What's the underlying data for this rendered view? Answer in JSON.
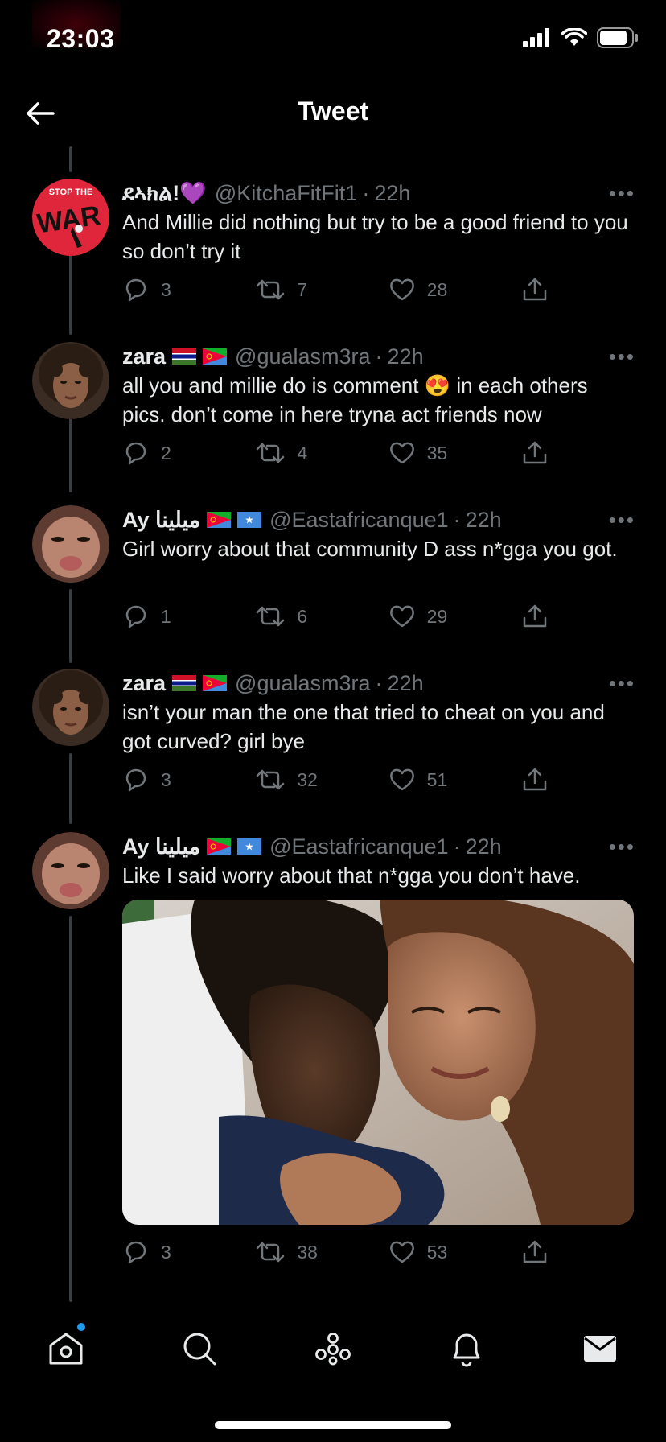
{
  "status_bar": {
    "time": "23:03",
    "icons": [
      "signal-icon",
      "wifi-icon",
      "battery-icon"
    ]
  },
  "header": {
    "title": "Tweet",
    "back_icon": "arrow-left-icon"
  },
  "tweets": [
    {
      "display_name": "ደኣክል!💜",
      "handle": "@KitchaFitFit1",
      "time": "22h",
      "text": "And Millie did nothing but try to be a good friend to you so don’t try it",
      "replies": "3",
      "retweets": "7",
      "likes": "28",
      "avatar": "stop-the-war-avatar"
    },
    {
      "display_name": "zara",
      "flags": [
        "gambia-flag",
        "eritrea-flag"
      ],
      "handle": "@gualasm3ra",
      "time": "22h",
      "text": "all you and millie do is comment 😍 in each others pics. don’t come in here tryna act friends now",
      "replies": "2",
      "retweets": "4",
      "likes": "35",
      "avatar": "zara-avatar"
    },
    {
      "display_name": "Ay ميلينا",
      "flags": [
        "eritrea-flag",
        "somalia-flag"
      ],
      "handle": "@Eastafricanque1",
      "time": "22h",
      "text": "Girl worry about that community D ass n*gga you got.",
      "replies": "1",
      "retweets": "6",
      "likes": "29",
      "avatar": "ay-avatar"
    },
    {
      "display_name": "zara",
      "flags": [
        "gambia-flag",
        "eritrea-flag"
      ],
      "handle": "@gualasm3ra",
      "time": "22h",
      "text": "isn’t your man the one that tried to cheat on you and got curved? girl bye",
      "replies": "3",
      "retweets": "32",
      "likes": "51",
      "avatar": "zara-avatar"
    },
    {
      "display_name": "Ay ميلينا",
      "flags": [
        "eritrea-flag",
        "somalia-flag"
      ],
      "handle": "@Eastafricanque1",
      "time": "22h",
      "text": "Like I said worry about that n*gga you don’t have.",
      "replies": "3",
      "retweets": "38",
      "likes": "53",
      "avatar": "ay-avatar",
      "media": "couple-photo"
    }
  ],
  "tab_bar": {
    "items": [
      "home-icon",
      "search-icon",
      "spaces-icon",
      "notifications-icon",
      "messages-icon"
    ],
    "home_badge": true
  },
  "colors": {
    "background": "#000000",
    "text": "#e7e9ea",
    "secondary": "#71767b",
    "accent": "#1d9bf0"
  }
}
